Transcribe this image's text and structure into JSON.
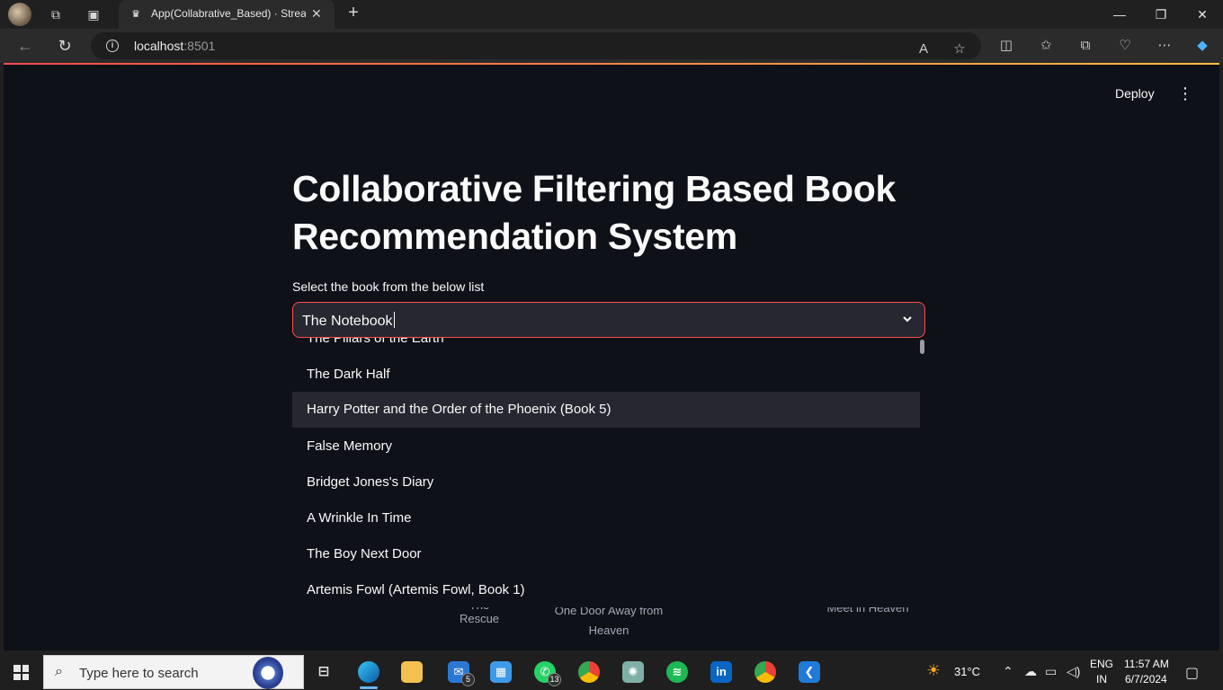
{
  "browser": {
    "tab_title": "App(Collabrative_Based) · Streamlit",
    "url_host": "localhost",
    "url_port": ":8501"
  },
  "app": {
    "deploy_label": "Deploy",
    "title": "Collaborative Filtering Based Book Recommendation System",
    "select_label": "Select the book from the below list",
    "select_value": "The Notebook",
    "dropdown_items": [
      "The Pillars of the Earth",
      "The Dark Half",
      "Harry Potter and the Order of the Phoenix (Book 5)",
      "False Memory",
      "Bridget Jones's Diary",
      "A Wrinkle In Time",
      "The Boy Next Door",
      "Artemis Fowl (Artemis Fowl, Book 1)"
    ],
    "highlighted_index": 2,
    "behind_captions": [
      "The Rescue",
      "One Door Away from Heaven",
      "Meet in Heaven"
    ]
  },
  "taskbar": {
    "search_placeholder": "Type here to search",
    "mail_badge": "5",
    "whatsapp_badge": "13",
    "temperature": "31°C",
    "lang_line1": "ENG",
    "lang_line2": "IN",
    "time": "11:57 AM",
    "date": "6/7/2024"
  },
  "colors": {
    "accent": "#ff4b4b",
    "app_bg": "#0e1117",
    "widget_bg": "#262730"
  }
}
